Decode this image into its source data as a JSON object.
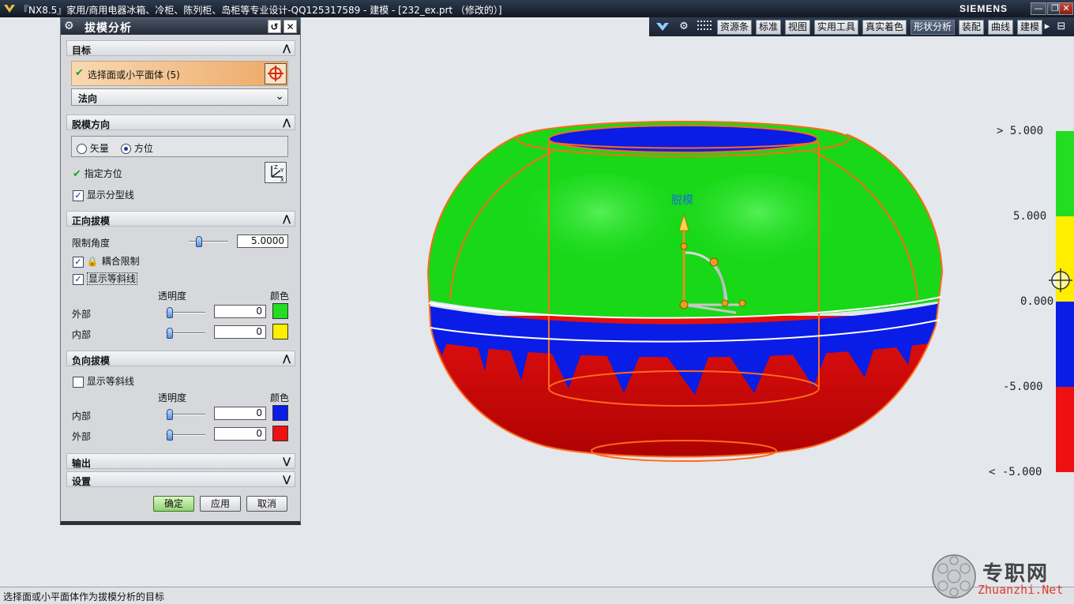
{
  "window": {
    "title": "『NX8.5』家用/商用电器冰箱、冷柜、陈列柜、岛柜等专业设计-QQ125317589 - 建模 - [232_ex.prt （修改的）]",
    "brand": "SIEMENS",
    "min_glyph": "—",
    "restore_glyph": "❐",
    "close_glyph": "✕"
  },
  "toolbar": {
    "tabs": [
      "资源条",
      "标准",
      "视图",
      "实用工具",
      "真实着色",
      "形状分析",
      "装配",
      "曲线",
      "建模"
    ],
    "active_tab": "形状分析",
    "more_glyph": "▸",
    "end_glyph": "⊟"
  },
  "dialog": {
    "title": "拔模分析",
    "reset_glyph": "↺",
    "close_glyph": "✕",
    "target": {
      "header": "目标",
      "select_label": "选择面或小平面体 (5)",
      "mode_value": "法向"
    },
    "draft_direction": {
      "header": "脱模方向",
      "radio_vector": "矢量",
      "radio_orientation": "方位",
      "specify_label": "指定方位",
      "show_parting_line": "显示分型线"
    },
    "positive_draft": {
      "header": "正向拔模",
      "limit_angle_label": "限制角度",
      "limit_angle_value": "5.0000",
      "coupled_limit": "耦合限制",
      "show_isoclines": "显示等斜线",
      "transparency_header": "透明度",
      "color_header": "颜色",
      "outside_label": "外部",
      "outside_value": "0",
      "inside_label": "内部",
      "inside_value": "0"
    },
    "negative_draft": {
      "header": "负向拔模",
      "show_isoclines": "显示等斜线",
      "transparency_header": "透明度",
      "color_header": "颜色",
      "inside_label": "内部",
      "inside_value": "0",
      "outside_label": "外部",
      "outside_value": "0"
    },
    "output_header": "输出",
    "settings_header": "设置",
    "ok_label": "确定",
    "apply_label": "应用",
    "cancel_label": "取消"
  },
  "colors": {
    "pos_outside": "#22dd22",
    "pos_inside": "#ffee00",
    "neg_inside": "#0a1de6",
    "neg_outside": "#ee1111"
  },
  "viewport": {
    "draft_label": "脱模"
  },
  "legend": {
    "labels": [
      "> 5.000",
      "5.000",
      "0.000",
      "-5.000",
      "< -5.000"
    ],
    "band_colors": [
      "#22dd22",
      "#ffee00",
      "#0a1de6",
      "#ee1111"
    ]
  },
  "status": {
    "text": "选择面或小平面体作为拔模分析的目标"
  },
  "watermark": {
    "title": "专职网",
    "subtitle": "Zhuanzhi.Net"
  }
}
